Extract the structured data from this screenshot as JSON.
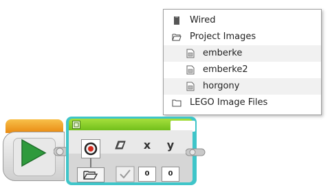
{
  "menu": {
    "items": [
      {
        "label": "Wired",
        "icon": "file-block-icon",
        "level": 0,
        "shaded": false
      },
      {
        "label": "Project Images",
        "icon": "folder-open-icon",
        "level": 0,
        "shaded": false
      },
      {
        "label": "emberke",
        "icon": "image-file-icon",
        "level": 1,
        "shaded": true
      },
      {
        "label": "emberke2",
        "icon": "image-file-icon",
        "level": 1,
        "shaded": false
      },
      {
        "label": "horgony",
        "icon": "image-file-icon",
        "level": 1,
        "shaded": true
      },
      {
        "label": "LEGO Image Files",
        "icon": "folder-closed-icon",
        "level": 0,
        "shaded": false
      }
    ]
  },
  "display_block": {
    "param_x_label": "x",
    "param_y_label": "y",
    "x_value": "0",
    "y_value": "0"
  },
  "colors": {
    "start_orange": "#f0a028",
    "play_green": "#2e9a3c",
    "display_teal": "#3fc5c9",
    "header_green": "#8ccf2a"
  }
}
